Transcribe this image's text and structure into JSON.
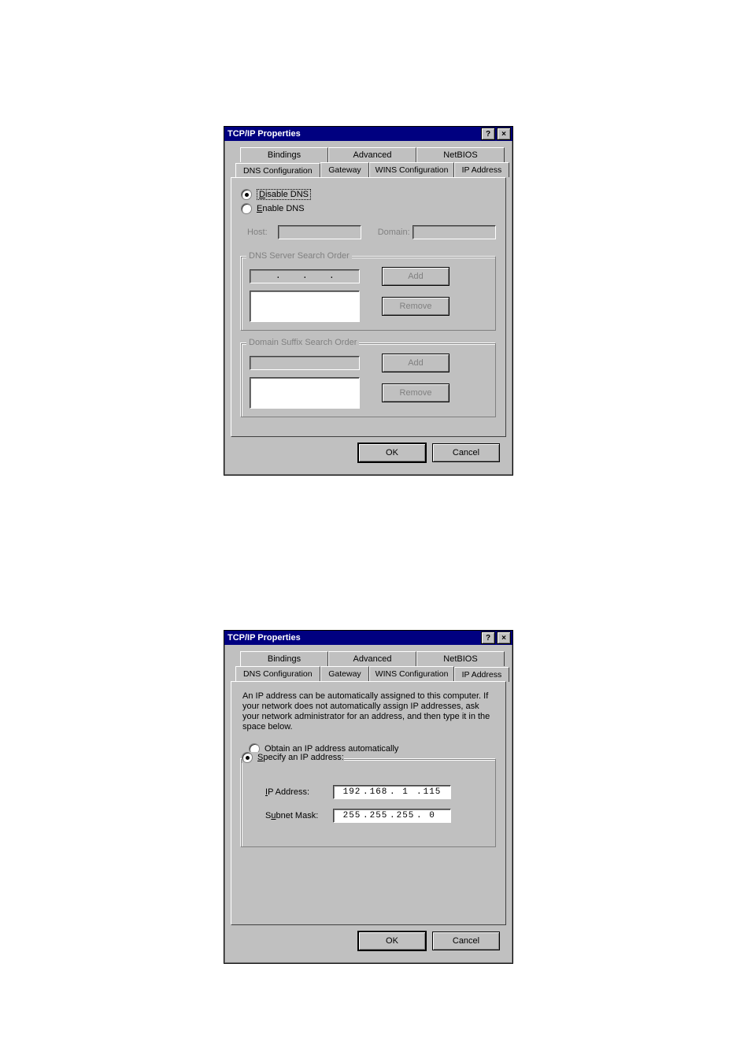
{
  "dialog1": {
    "title": "TCP/IP Properties",
    "tabs_row1": [
      "Bindings",
      "Advanced",
      "NetBIOS"
    ],
    "tabs_row2": [
      "DNS Configuration",
      "Gateway",
      "WINS Configuration",
      "IP Address"
    ],
    "active_tab": "DNS Configuration",
    "radio_disable": "Disable DNS",
    "radio_enable": "Enable DNS",
    "host_label": "Host:",
    "domain_label": "Domain:",
    "group_dns": "DNS Server Search Order",
    "group_suffix": "Domain Suffix Search Order",
    "btn_add": "Add",
    "btn_remove": "Remove",
    "btn_ok": "OK",
    "btn_cancel": "Cancel"
  },
  "dialog2": {
    "title": "TCP/IP Properties",
    "tabs_row1": [
      "Bindings",
      "Advanced",
      "NetBIOS"
    ],
    "tabs_row2": [
      "DNS Configuration",
      "Gateway",
      "WINS Configuration",
      "IP Address"
    ],
    "active_tab": "IP Address",
    "blurb": "An IP address can be automatically assigned to this computer. If your network does not automatically assign IP addresses, ask your network administrator for an address, and then type it in the space below.",
    "radio_obtain": "Obtain an IP address automatically",
    "radio_specify": "Specify an IP address:",
    "ip_label": "IP Address:",
    "ip_value": [
      "192",
      "168",
      " 1 ",
      "115"
    ],
    "mask_label": "Subnet Mask:",
    "mask_value": [
      "255",
      "255",
      "255",
      " 0"
    ],
    "btn_ok": "OK",
    "btn_cancel": "Cancel"
  }
}
